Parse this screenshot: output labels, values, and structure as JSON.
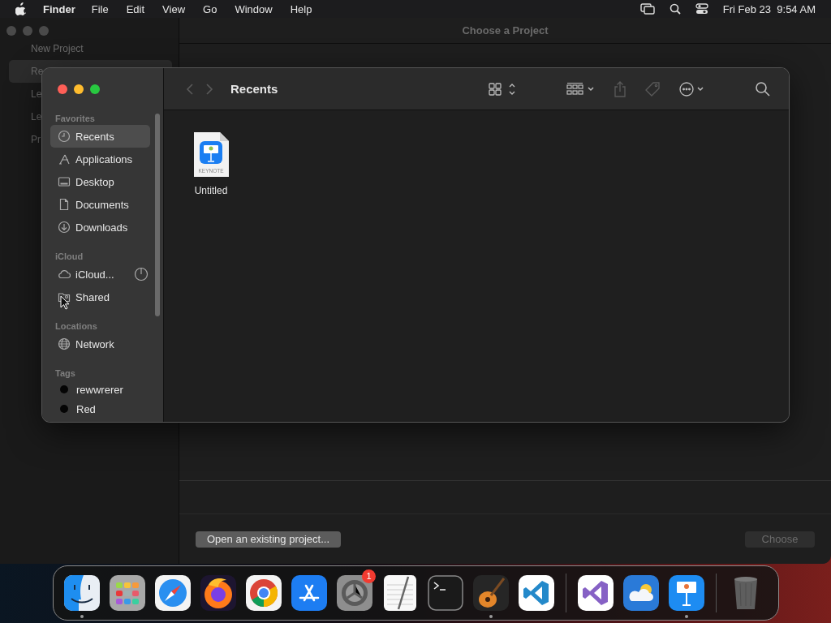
{
  "menu_bar": {
    "app": "Finder",
    "menus": [
      "File",
      "Edit",
      "View",
      "Go",
      "Window",
      "Help"
    ],
    "clock": "Fri Feb 23  9:54 AM"
  },
  "project_window": {
    "title": "Choose a Project",
    "sidebar": [
      {
        "label": "New Project",
        "selected": false
      },
      {
        "label": "Re",
        "selected": true
      },
      {
        "label": "Le",
        "selected": false
      },
      {
        "label": "Le",
        "selected": false
      },
      {
        "label": "Pr",
        "selected": false
      }
    ],
    "buttons": [
      {
        "label": "Open an existing project...",
        "disabled": false
      },
      {
        "label": "Choose",
        "disabled": true
      }
    ]
  },
  "finder": {
    "title": "Recents",
    "nav": [
      {
        "kind": "back",
        "disabled": true
      },
      {
        "kind": "forward",
        "disabled": true
      }
    ],
    "tools": [
      {
        "kind": "icon-view",
        "disabled": false
      },
      {
        "kind": "group",
        "disabled": false
      },
      {
        "kind": "share",
        "disabled": true
      },
      {
        "kind": "tag",
        "disabled": true
      },
      {
        "kind": "more",
        "disabled": false
      },
      {
        "kind": "search",
        "disabled": false
      }
    ],
    "sidebar": [
      {
        "title": "Favorites",
        "items": [
          {
            "label": "Recents",
            "kind": "clock",
            "selected": true
          },
          {
            "label": "Applications",
            "kind": "apps",
            "selected": false
          },
          {
            "label": "Desktop",
            "kind": "desktop",
            "selected": false
          },
          {
            "label": "Documents",
            "kind": "document",
            "selected": false
          },
          {
            "label": "Downloads",
            "kind": "download",
            "selected": false
          }
        ]
      },
      {
        "title": "iCloud",
        "items": [
          {
            "label": "iCloud...",
            "kind": "cloud",
            "selected": false,
            "progress": true
          },
          {
            "label": "Shared",
            "kind": "shared",
            "selected": false
          }
        ]
      },
      {
        "title": "Locations",
        "items": [
          {
            "label": "Network",
            "kind": "globe",
            "selected": false
          }
        ]
      },
      {
        "title": "Tags",
        "items": [
          {
            "label": "rewwrerer",
            "kind": "tag",
            "selected": false,
            "color": "#050505"
          },
          {
            "label": "Red",
            "kind": "tag",
            "selected": false,
            "color": "#050505"
          }
        ]
      }
    ],
    "files": [
      {
        "name": "Untitled",
        "kind": "keynote",
        "icon_text": "KEYNOTE"
      }
    ]
  },
  "dock": {
    "sections": [
      [
        {
          "kind": "finder",
          "running": true
        },
        {
          "kind": "launchpad",
          "running": false
        },
        {
          "kind": "safari",
          "running": false
        },
        {
          "kind": "firefox",
          "running": false
        },
        {
          "kind": "chrome",
          "running": false
        },
        {
          "kind": "appstore",
          "running": false
        },
        {
          "kind": "settings",
          "running": false,
          "badge": "1"
        },
        {
          "kind": "textedit",
          "running": false
        },
        {
          "kind": "terminal",
          "running": false
        },
        {
          "kind": "garageband",
          "running": true
        },
        {
          "kind": "vscode",
          "running": false
        }
      ],
      [
        {
          "kind": "visualstudio",
          "running": false
        },
        {
          "kind": "weather",
          "running": false
        },
        {
          "kind": "keynote",
          "running": true
        }
      ],
      [
        {
          "kind": "trash",
          "running": false
        }
      ]
    ]
  }
}
